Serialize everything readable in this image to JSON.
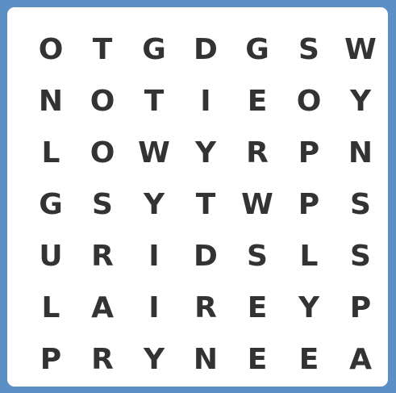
{
  "puzzle": {
    "grid": [
      [
        "O",
        "T",
        "G",
        "D",
        "G",
        "S",
        "W"
      ],
      [
        "N",
        "O",
        "T",
        "I",
        "E",
        "O",
        "Y"
      ],
      [
        "L",
        "O",
        "W",
        "Y",
        "R",
        "P",
        "N"
      ],
      [
        "G",
        "S",
        "Y",
        "T",
        "W",
        "P",
        "S"
      ],
      [
        "U",
        "R",
        "I",
        "D",
        "S",
        "L",
        "S"
      ],
      [
        "L",
        "A",
        "I",
        "R",
        "E",
        "Y",
        "P"
      ],
      [
        "P",
        "R",
        "Y",
        "N",
        "E",
        "E",
        "A"
      ]
    ]
  },
  "colors": {
    "background": "#5b8fc6",
    "board": "#ffffff",
    "letter": "#333333"
  }
}
